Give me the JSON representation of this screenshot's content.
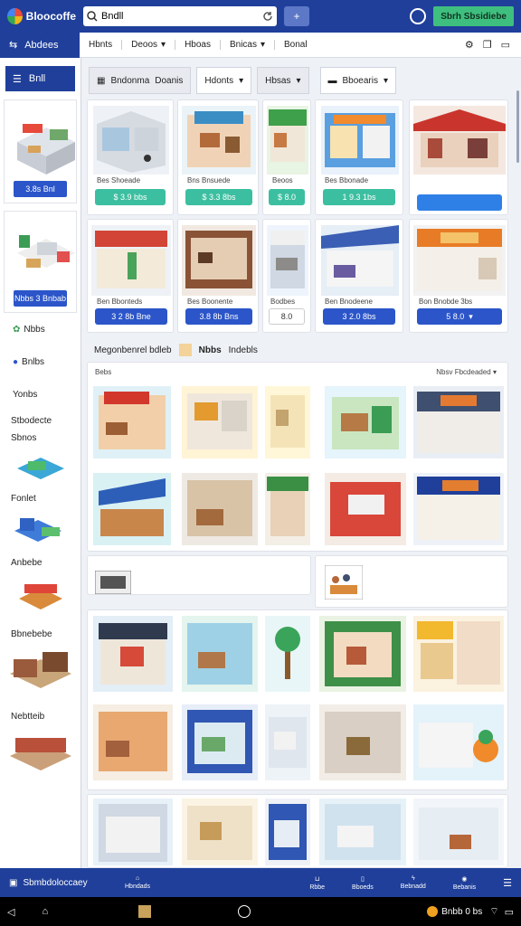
{
  "app": {
    "name": "Bloocoffe",
    "search_value": "Bndll",
    "cta_label": "Sbrh Sbsidiebe"
  },
  "toolbar": {
    "left_label": "Abdees",
    "items": [
      "Hbnts",
      "Deoos",
      "Hboas",
      "Bnicas",
      "Bonal"
    ]
  },
  "sidebar": {
    "head": "Bnll",
    "card1_btn": "3.8s  Bnl",
    "card2_btn": "Nbbs 3 Bnbab",
    "links": [
      "Nbbs",
      "Bnlbs",
      "Yonbs"
    ],
    "categories": [
      "Stbodecte",
      "Sbnos",
      "Fonlet",
      "Anbebe",
      "Bbnebebe",
      "Nebtteib"
    ]
  },
  "filters": [
    "Bndonma",
    "Doanis",
    "Hdonts",
    "Hbsas",
    "Bboearis"
  ],
  "row1_captions": [
    "Bes Shoeade",
    "Bns Bnsuede",
    "Beoos",
    "Bes Bbonade",
    ""
  ],
  "row1_prices": [
    "$ 3.9 bbs",
    "$ 3.3 8bs",
    "$ 8.0",
    "1  9.3 1bs",
    ""
  ],
  "row2_captions": [
    "Ben Bbonteds",
    "Bes Boonente",
    "Bodbes",
    "Ben Bnodeene",
    "Bon Bnobde 3bs"
  ],
  "row2_prices": [
    "3 2 8b Bne",
    "3.8 8b Bns",
    "8.0",
    "3 2.0 8bs",
    "5 8.0"
  ],
  "section": {
    "title": "Megonbenrel bdleb",
    "label1": "Nbbs",
    "label2": "Indebls"
  },
  "panel": {
    "left": "Bebs",
    "right": "Nbsv Fbcdeaded"
  },
  "bottombar": {
    "left": "Sbmbdoloccaey",
    "items": [
      "Hbndads",
      "Rbbe",
      "Bboeds",
      "Bebnadd",
      "Bebanis"
    ]
  },
  "navbar": {
    "status": "Bnbb 0 bs"
  },
  "colors": {
    "brand": "#1f3f9a",
    "accent": "#3fbf7f",
    "price": "#2b55c9",
    "teal": "#3cbfa0"
  }
}
